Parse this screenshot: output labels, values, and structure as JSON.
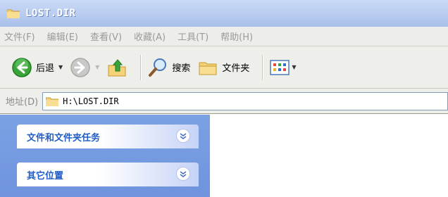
{
  "window": {
    "title": "LOST.DIR",
    "icon": "folder-icon"
  },
  "menu": {
    "items": [
      "文件(F)",
      "编辑(E)",
      "查看(V)",
      "收藏(A)",
      "工具(T)",
      "帮助(H)"
    ]
  },
  "toolbar": {
    "back_label": "后退",
    "search_label": "搜索",
    "folders_label": "文件夹",
    "icons": [
      "back-arrow-icon",
      "forward-arrow-icon",
      "up-folder-icon",
      "search-icon",
      "folders-icon",
      "views-icon"
    ]
  },
  "address": {
    "label": "地址(D)",
    "path": "H:\\LOST.DIR"
  },
  "taskpane": {
    "panels": [
      {
        "label": "文件和文件夹任务"
      },
      {
        "label": "其它位置"
      }
    ]
  },
  "colors": {
    "title_bar": "#b9ccf0",
    "task_pane": "#7ba1e4",
    "panel_text": "#215dc6"
  }
}
